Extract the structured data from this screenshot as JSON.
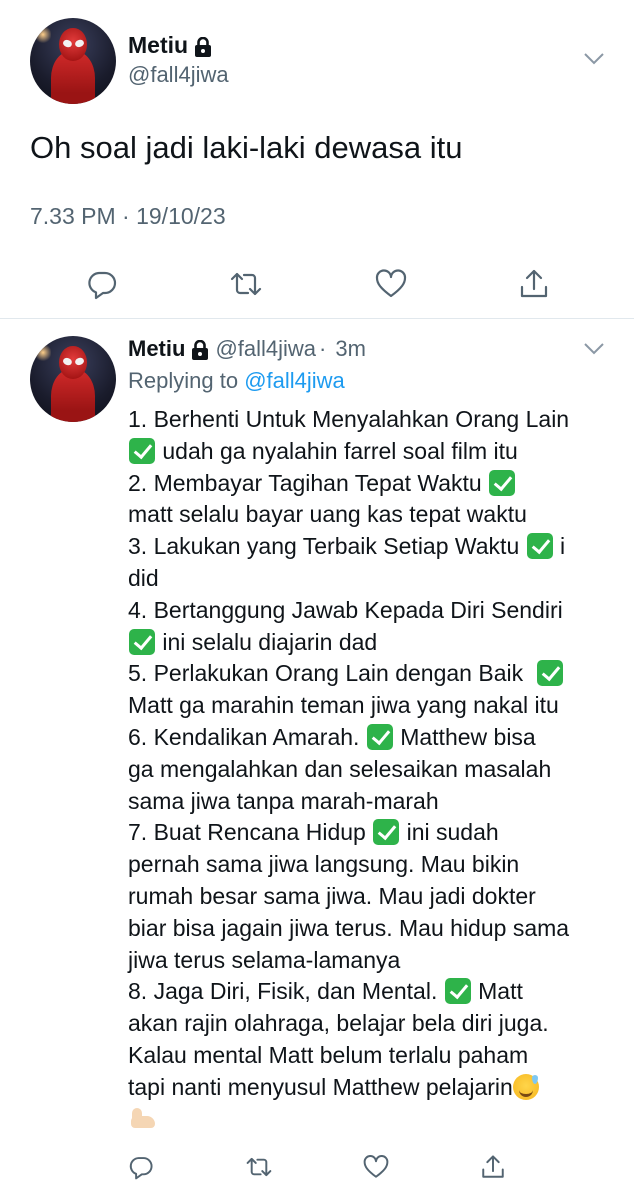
{
  "main_tweet": {
    "author_name": "Metiu",
    "handle": "@fall4jiwa",
    "text": "Oh soal jadi laki-laki dewasa itu",
    "timestamp": "7.33 PM · 19/10/23",
    "icons": [
      "lock-icon",
      "chevron-down-icon",
      "reply-icon",
      "retweet-icon",
      "like-icon",
      "share-icon"
    ]
  },
  "reply_tweet": {
    "author_name": "Metiu",
    "handle": "@fall4jiwa",
    "separator": "·",
    "time_ago": "3m",
    "replying_prefix": "Replying to ",
    "replying_to": "@fall4jiwa",
    "lines": [
      {
        "pre": "1. Berhenti Untuk Menyalahkan Orang Lain",
        "check": false,
        "post": ""
      },
      {
        "pre": "",
        "check": true,
        "post": " udah ga nyalahin farrel soal film itu"
      },
      {
        "pre": "2. Membayar Tagihan Tepat Waktu ",
        "check": true,
        "post": ""
      },
      {
        "pre": "matt selalu bayar uang kas tepat waktu",
        "check": false,
        "post": ""
      },
      {
        "pre": "3. Lakukan yang Terbaik Setiap Waktu ",
        "check": true,
        "post": " i"
      },
      {
        "pre": "did",
        "check": false,
        "post": ""
      },
      {
        "pre": "4. Bertanggung Jawab Kepada Diri Sendiri",
        "check": false,
        "post": ""
      },
      {
        "pre": "",
        "check": true,
        "post": " ini selalu diajarin dad"
      },
      {
        "pre": "5. Perlakukan Orang Lain dengan Baik  ",
        "check": true,
        "post": ""
      },
      {
        "pre": "Matt ga marahin teman jiwa yang nakal itu",
        "check": false,
        "post": ""
      },
      {
        "pre": "6. Kendalikan Amarah. ",
        "check": true,
        "post": " Matthew bisa"
      },
      {
        "pre": "ga mengalahkan dan selesaikan masalah",
        "check": false,
        "post": ""
      },
      {
        "pre": "sama jiwa tanpa marah-marah",
        "check": false,
        "post": ""
      },
      {
        "pre": "7. Buat Rencana Hidup ",
        "check": true,
        "post": " ini sudah"
      },
      {
        "pre": "pernah sama jiwa langsung. Mau bikin",
        "check": false,
        "post": ""
      },
      {
        "pre": "rumah besar sama jiwa. Mau jadi dokter",
        "check": false,
        "post": ""
      },
      {
        "pre": "biar bisa jagain jiwa terus. Mau hidup sama",
        "check": false,
        "post": ""
      },
      {
        "pre": "jiwa terus selama-lamanya",
        "check": false,
        "post": ""
      },
      {
        "pre": "8. Jaga Diri, Fisik, dan Mental. ",
        "check": true,
        "post": " Matt"
      },
      {
        "pre": "akan rajin olahraga, belajar bela diri juga.",
        "check": false,
        "post": ""
      },
      {
        "pre": "Kalau mental Matt belum terlalu paham",
        "check": false,
        "post": ""
      },
      {
        "pre": "tapi nanti menyusul Matthew pelajarin",
        "check": false,
        "post": "",
        "emoji": "sweat-smile-emoji"
      },
      {
        "pre": "",
        "check": false,
        "post": "",
        "emoji": "flexed-biceps-emoji"
      }
    ]
  },
  "colors": {
    "text": "#0f1419",
    "secondary": "#536471",
    "link": "#1d9bf0",
    "divider": "#e1e8ed",
    "check": "#2eb34a"
  }
}
